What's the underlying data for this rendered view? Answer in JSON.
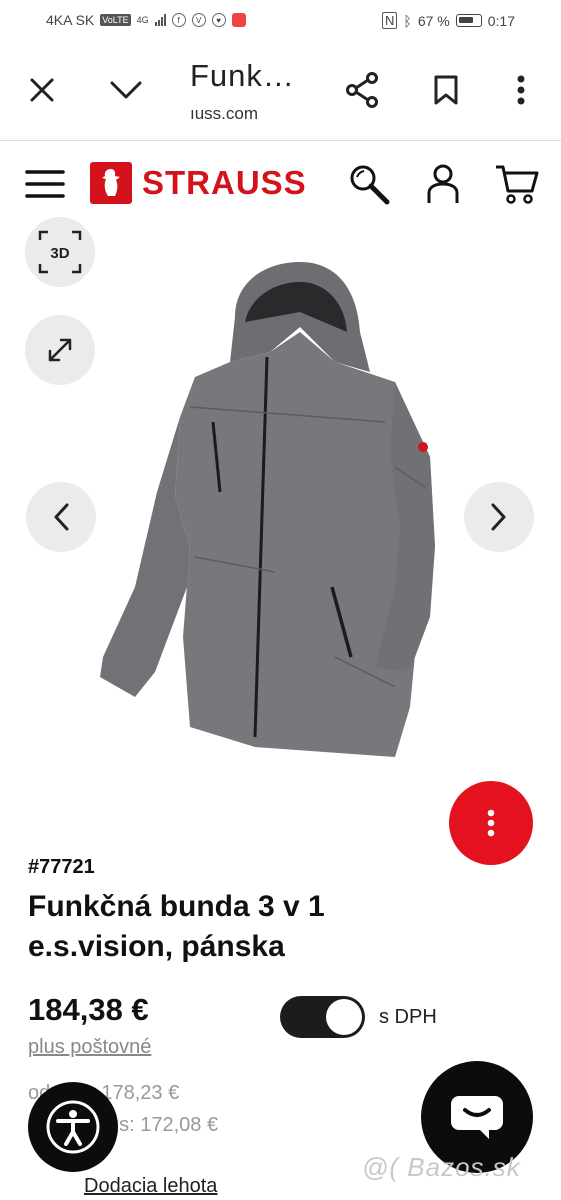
{
  "status_bar": {
    "carrier": "4KA SK",
    "volte": "VoLTE",
    "network": "4G",
    "battery_percent": "67 %",
    "time": "0:17"
  },
  "browser": {
    "title": "Funk…",
    "url": "ıuss.com",
    "icons": [
      "close-icon",
      "chevron-down-icon",
      "share-icon",
      "bookmark-icon",
      "more-vertical-icon"
    ]
  },
  "site_header": {
    "brand": "STRAUSS",
    "icons": [
      "menu-icon",
      "search-icon",
      "user-icon",
      "cart-icon"
    ],
    "brand_color": "#d4121b"
  },
  "gallery": {
    "view_3d_label": "3D",
    "icons": [
      "expand-icon",
      "chevron-left-icon",
      "chevron-right-icon",
      "more-vertical-icon"
    ],
    "fab_color": "#e3121e"
  },
  "product": {
    "sku": "#77721",
    "title": "Funkčná bunda 3 v 1 e.s.vision, pánska",
    "price": "184,38 €",
    "shipping_label": "plus poštovné",
    "vat_toggle_label": "s DPH",
    "vat_toggle_on": true,
    "tier_price_1": "od   Kus: 178,23 €",
    "tier_price_2": "us: 172,08 €",
    "delivery_link": "Dodacia lehota"
  },
  "watermark": "@( Bazos.sk"
}
